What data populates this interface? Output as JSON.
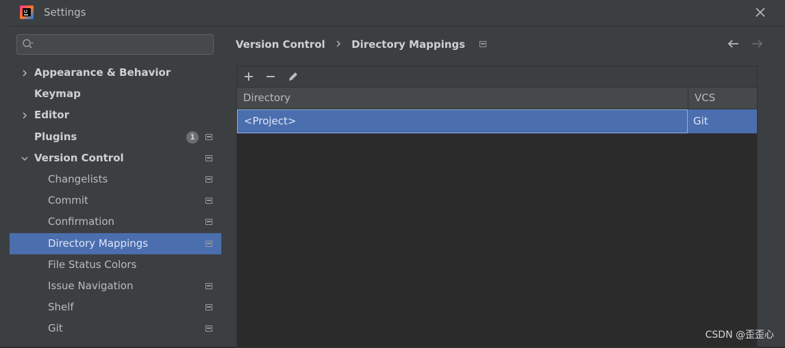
{
  "window": {
    "title": "Settings"
  },
  "sidebar": {
    "search": {
      "value": "",
      "placeholder": ""
    },
    "items": [
      {
        "label": "Appearance & Behavior",
        "level": 0,
        "expandable": true,
        "expanded": false,
        "bold": true
      },
      {
        "label": "Keymap",
        "level": 0,
        "expandable": false,
        "bold": true
      },
      {
        "label": "Editor",
        "level": 0,
        "expandable": true,
        "expanded": false,
        "bold": true
      },
      {
        "label": "Plugins",
        "level": 0,
        "expandable": false,
        "bold": true,
        "badge": "1",
        "project_icon": true
      },
      {
        "label": "Version Control",
        "level": 0,
        "expandable": true,
        "expanded": true,
        "bold": true,
        "project_icon": true
      },
      {
        "label": "Changelists",
        "level": 1,
        "project_icon": true
      },
      {
        "label": "Commit",
        "level": 1,
        "project_icon": true
      },
      {
        "label": "Confirmation",
        "level": 1,
        "project_icon": true
      },
      {
        "label": "Directory Mappings",
        "level": 1,
        "project_icon": true,
        "selected": true
      },
      {
        "label": "File Status Colors",
        "level": 1,
        "project_icon": false
      },
      {
        "label": "Issue Navigation",
        "level": 1,
        "project_icon": true
      },
      {
        "label": "Shelf",
        "level": 1,
        "project_icon": true
      },
      {
        "label": "Git",
        "level": 1,
        "project_icon": true
      }
    ]
  },
  "breadcrumb": {
    "parent": "Version Control",
    "current": "Directory Mappings"
  },
  "mappings": {
    "columns": {
      "directory": "Directory",
      "vcs": "VCS"
    },
    "rows": [
      {
        "directory": "<Project>",
        "vcs": "Git"
      }
    ]
  },
  "colors": {
    "selection": "#4b6eaf",
    "background": "#3c3f41",
    "table_body": "#2b2b2b"
  },
  "icons": [
    "app-logo-icon",
    "close-icon",
    "search-icon",
    "chevron-right-icon",
    "chevron-down-icon",
    "project-scope-icon",
    "back-arrow-icon",
    "forward-arrow-icon",
    "add-icon",
    "remove-icon",
    "edit-icon"
  ],
  "watermark": "CSDN @歪歪心"
}
